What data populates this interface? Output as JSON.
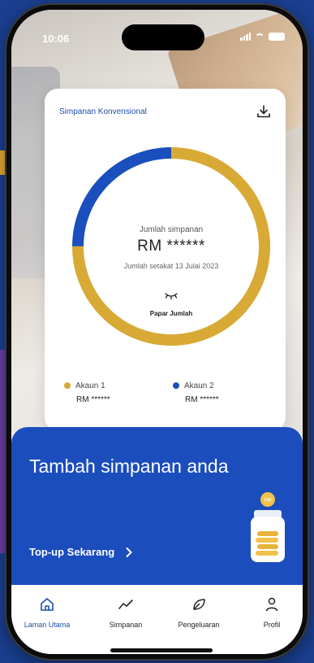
{
  "status_bar": {
    "time": "10:06"
  },
  "savings_card": {
    "title": "Simpanan Konvensional",
    "total_label": "Jumlah simpanan",
    "total_amount": "RM ******",
    "as_of": "Jumlah setakat 13 Julai 2023",
    "show_amount_label": "Papar Jumlah",
    "accounts": [
      {
        "name": "Akaun 1",
        "amount": "RM ******",
        "color": "#d8aa35",
        "share": 0.75
      },
      {
        "name": "Akaun 2",
        "amount": "RM ******",
        "color": "#1b4fbd",
        "share": 0.25
      }
    ]
  },
  "promo": {
    "title": "Tambah simpanan anda",
    "cta_label": "Top-up Sekarang",
    "jar_coin_text": "RM"
  },
  "nav": {
    "items": [
      {
        "label": "Laman Utama",
        "icon": "home-icon",
        "active": true
      },
      {
        "label": "Simpanan",
        "icon": "trend-icon",
        "active": false
      },
      {
        "label": "Pengeluaran",
        "icon": "leaf-icon",
        "active": false
      },
      {
        "label": "Profil",
        "icon": "person-icon",
        "active": false
      }
    ]
  },
  "colors": {
    "accent": "#1b4dbd",
    "gold": "#d8aa35",
    "page_bg": "#1a3f8f"
  }
}
